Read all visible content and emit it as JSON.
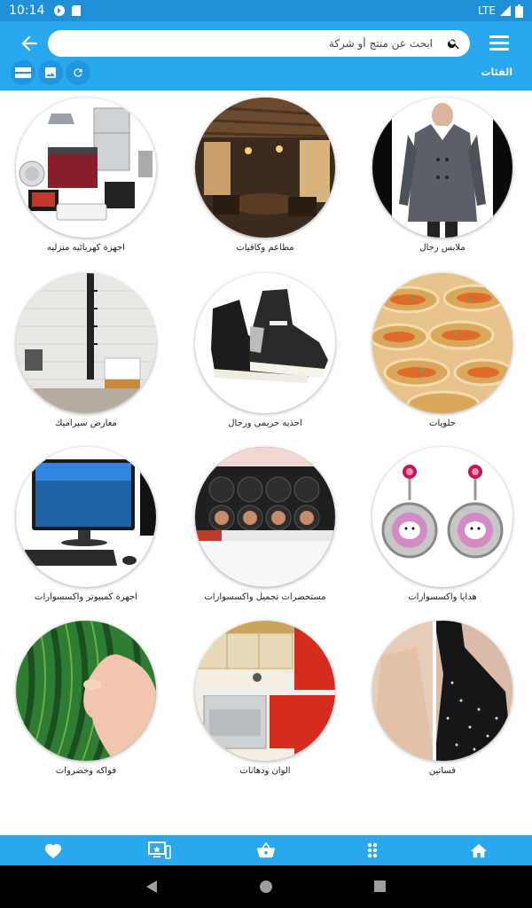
{
  "status_bar": {
    "time": "10:14",
    "network": "LTE"
  },
  "header": {
    "search_placeholder": "ابحث عن منتج أو شركة",
    "categories_title": "الفئات"
  },
  "categories": [
    {
      "label": "ملابس رجال",
      "icon": "men-coat-image"
    },
    {
      "label": "مطاعم وكافيات",
      "icon": "restaurant-image"
    },
    {
      "label": "اجهزة كهربائيه منزليه",
      "icon": "appliances-image"
    },
    {
      "label": "حلويات",
      "icon": "sweets-image"
    },
    {
      "label": "احذيه حريمى ورجال",
      "icon": "sneakers-image"
    },
    {
      "label": "معارض سيراميك",
      "icon": "ceramic-image"
    },
    {
      "label": "هدايا واكسسوارات",
      "icon": "earrings-image"
    },
    {
      "label": "مستحضرات تجميل واكسسوارات",
      "icon": "cosmetics-image"
    },
    {
      "label": "اجهزة كمبيوتر واكسسوارات",
      "icon": "computer-image"
    },
    {
      "label": "فساتين",
      "icon": "dresses-image"
    },
    {
      "label": "الوان ودهانات",
      "icon": "kitchen-paint-image"
    },
    {
      "label": "فواكه وخضروات",
      "icon": "watermelon-image"
    }
  ],
  "bottom_nav": [
    "heart-icon",
    "ads-icon",
    "basket-icon",
    "apps-icon",
    "home-icon"
  ],
  "colors": {
    "app_bar": "#29a8ef",
    "status_bar": "#1f8fd6"
  }
}
